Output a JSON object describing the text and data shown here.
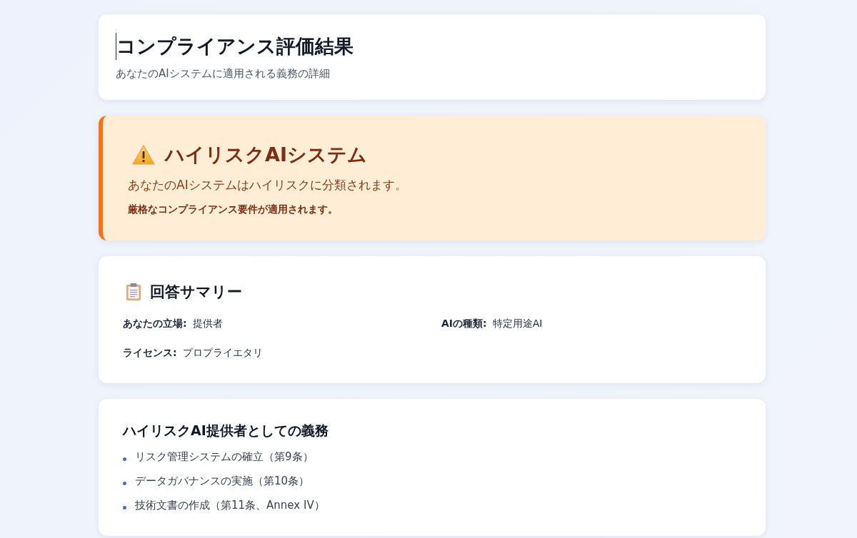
{
  "header": {
    "title": "コンプライアンス評価結果",
    "subtitle": "あなたのAIシステムに適用される義務の詳細"
  },
  "risk_banner": {
    "kind": "warning",
    "title": "ハイリスクAIシステム",
    "description": "あなたのAIシステムはハイリスクに分類されます。",
    "note": "厳格なコンプライアンス要件が適用されます。"
  },
  "summary": {
    "title": "回答サマリー",
    "fields": [
      {
        "label": "あなたの立場:",
        "value": "提供者"
      },
      {
        "label": "AIの種類:",
        "value": "特定用途AI"
      },
      {
        "label": "ライセンス:",
        "value": "プロプライエタリ"
      }
    ]
  },
  "obligations": {
    "title": "ハイリスクAI提供者としての義務",
    "items": [
      "リスク管理システムの確立（第9条）",
      "データガバナンスの実施（第10条）",
      "技術文書の作成（第11条、Annex IV）"
    ]
  }
}
